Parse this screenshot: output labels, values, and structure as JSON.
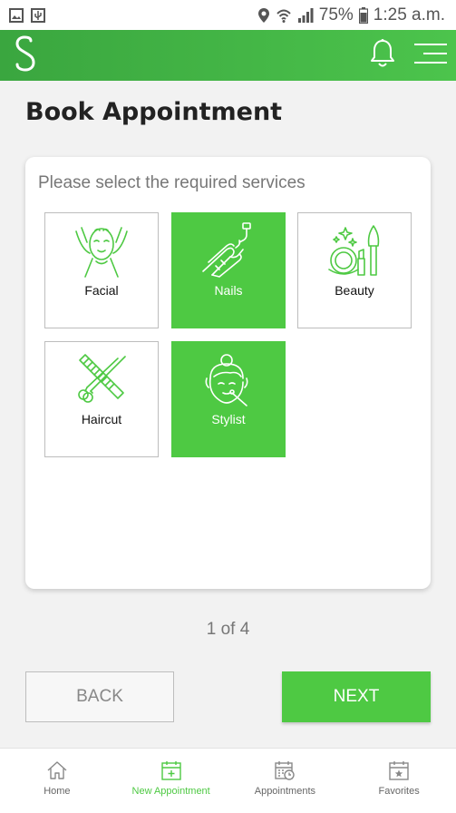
{
  "status_bar": {
    "battery": "75%",
    "time": "1:25 a.m."
  },
  "app_bar": {
    "logo_icon": "s-logo-icon",
    "bell_icon": "bell-icon",
    "menu_icon": "menu-icon"
  },
  "page": {
    "title": "Book Appointment"
  },
  "card": {
    "prompt": "Please select the required services",
    "services": [
      {
        "label": "Facial",
        "icon": "facial-icon",
        "selected": false
      },
      {
        "label": "Nails",
        "icon": "nails-icon",
        "selected": true
      },
      {
        "label": "Beauty",
        "icon": "beauty-icon",
        "selected": false
      },
      {
        "label": "Haircut",
        "icon": "haircut-icon",
        "selected": false
      },
      {
        "label": "Stylist",
        "icon": "stylist-icon",
        "selected": true
      }
    ]
  },
  "pager": {
    "text": "1 of 4"
  },
  "buttons": {
    "back": "BACK",
    "next": "NEXT"
  },
  "bottom_nav": {
    "items": [
      {
        "label": "Home",
        "icon": "home-icon",
        "active": false
      },
      {
        "label": "New Appointment",
        "icon": "calendar-add-icon",
        "active": true
      },
      {
        "label": "Appointments",
        "icon": "calendar-clock-icon",
        "active": false
      },
      {
        "label": "Favorites",
        "icon": "calendar-star-icon",
        "active": false
      }
    ]
  },
  "colors": {
    "accent": "#4ec943",
    "app_bar_start": "#3aa63f",
    "app_bar_end": "#4cc44c"
  }
}
